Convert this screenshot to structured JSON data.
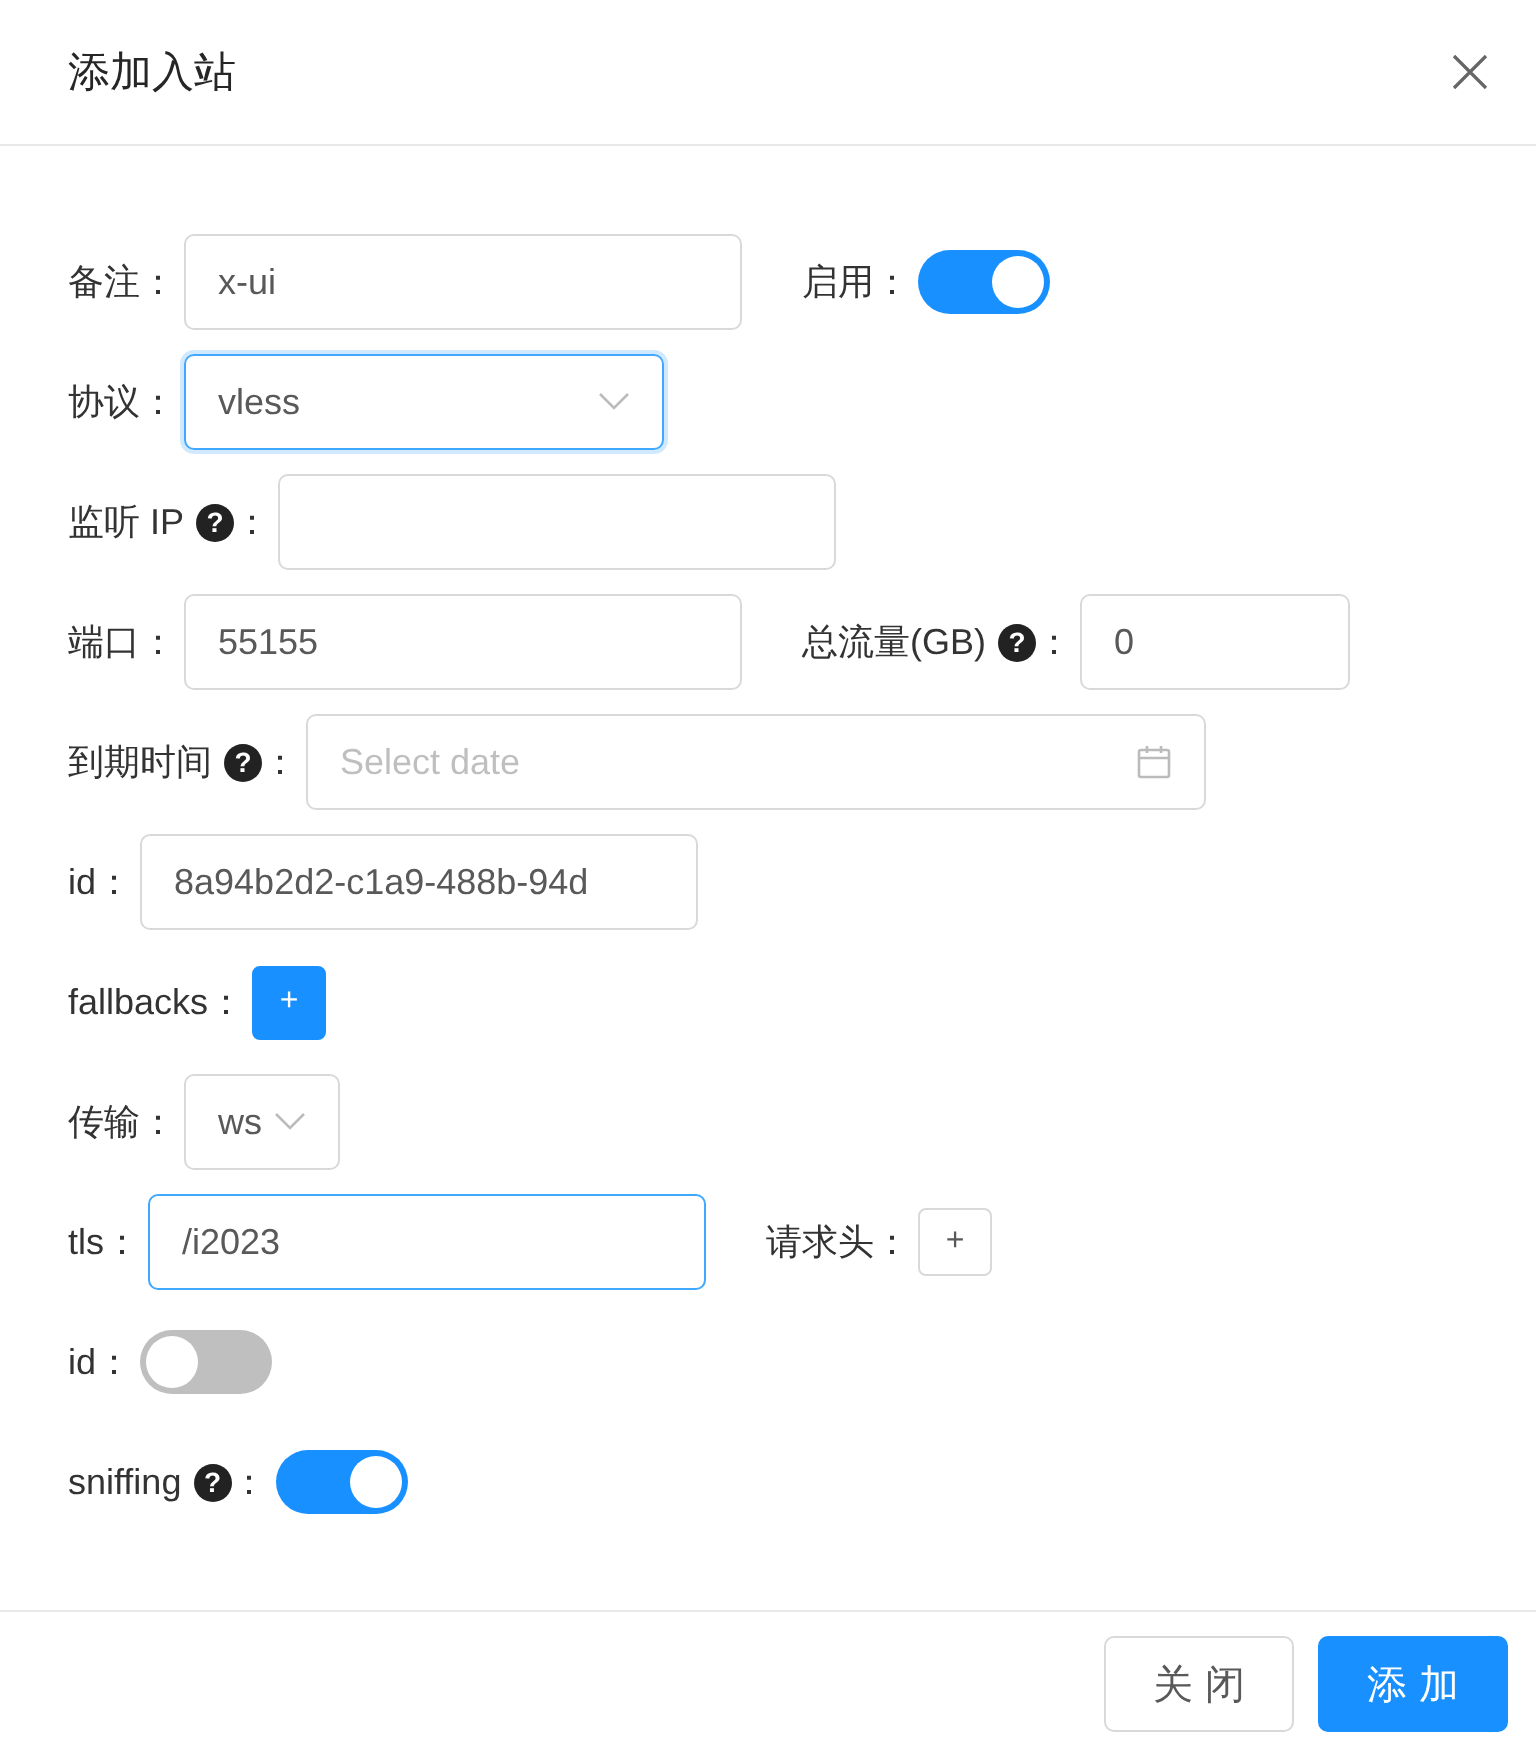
{
  "dialog": {
    "title": "添加入站"
  },
  "rows": [
    {
      "items": [
        {
          "label": "备注",
          "colon": "：",
          "kind": "input",
          "value": "x-ui",
          "focused": false
        },
        {
          "label": "启用",
          "colon": "：",
          "kind": "switch",
          "on": true
        }
      ]
    },
    {
      "items": [
        {
          "label": "协议",
          "colon": "：",
          "kind": "select",
          "value": "vless",
          "focused": true
        }
      ]
    },
    {
      "items": [
        {
          "label": "监听 IP",
          "help": "?",
          "colon": "：",
          "kind": "input",
          "focused": false
        }
      ]
    },
    {
      "items": [
        {
          "label": "端口",
          "colon": "：",
          "kind": "input",
          "value": "55155",
          "focused": false
        },
        {
          "label": "总流量(GB)",
          "help": "?",
          "colon": "：",
          "kind": "input",
          "value": "0",
          "focused": false
        }
      ]
    },
    {
      "items": [
        {
          "label": "到期时间",
          "help": "?",
          "colon": "：",
          "kind": "date",
          "placeholder": "Select date"
        }
      ]
    },
    {
      "items": [
        {
          "label": "id",
          "colon": "：",
          "kind": "input",
          "value": "8a94b2d2-c1a9-488b-94d",
          "focused": false
        }
      ]
    },
    {
      "items": [
        {
          "label": "fallbacks",
          "colon": "：",
          "kind": "add",
          "text": "+",
          "primary": true
        }
      ]
    },
    {
      "items": [
        {
          "label": "传输",
          "colon": "：",
          "kind": "select",
          "value": "ws",
          "focused": false
        }
      ]
    },
    {
      "items": [
        {
          "label": "tls",
          "colon": "：",
          "kind": "input",
          "value": "/i2023",
          "focused": true
        },
        {
          "label": "请求头",
          "colon": "：",
          "kind": "add",
          "text": "+",
          "primary": false
        }
      ]
    },
    {
      "items": [
        {
          "label": "id",
          "colon": "：",
          "kind": "switch",
          "on": false
        }
      ]
    },
    {
      "items": [
        {
          "label": "sniffing",
          "help": "?",
          "colon": "：",
          "kind": "switch",
          "on": true
        }
      ]
    }
  ],
  "footer": {
    "buttons": [
      {
        "label": "关 闭",
        "primary": false
      },
      {
        "label": "添 加",
        "primary": true
      }
    ]
  }
}
